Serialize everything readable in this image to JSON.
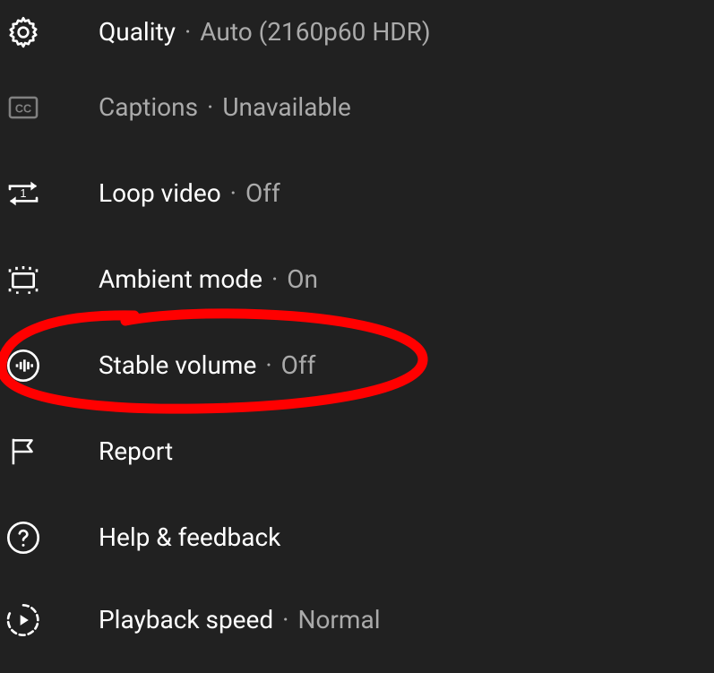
{
  "menu": {
    "items": [
      {
        "label": "Quality",
        "value": "Auto (2160p60 HDR)",
        "dimmed": false
      },
      {
        "label": "Captions",
        "value": "Unavailable",
        "dimmed": true
      },
      {
        "label": "Loop video",
        "value": "Off",
        "dimmed": false
      },
      {
        "label": "Ambient mode",
        "value": "On",
        "dimmed": false
      },
      {
        "label": "Stable volume",
        "value": "Off",
        "dimmed": false
      },
      {
        "label": "Report",
        "value": null,
        "dimmed": false
      },
      {
        "label": "Help & feedback",
        "value": null,
        "dimmed": false
      },
      {
        "label": "Playback speed",
        "value": "Normal",
        "dimmed": false
      }
    ]
  },
  "annotation": {
    "highlighted_item": "Stable volume",
    "color": "#ff0000"
  }
}
